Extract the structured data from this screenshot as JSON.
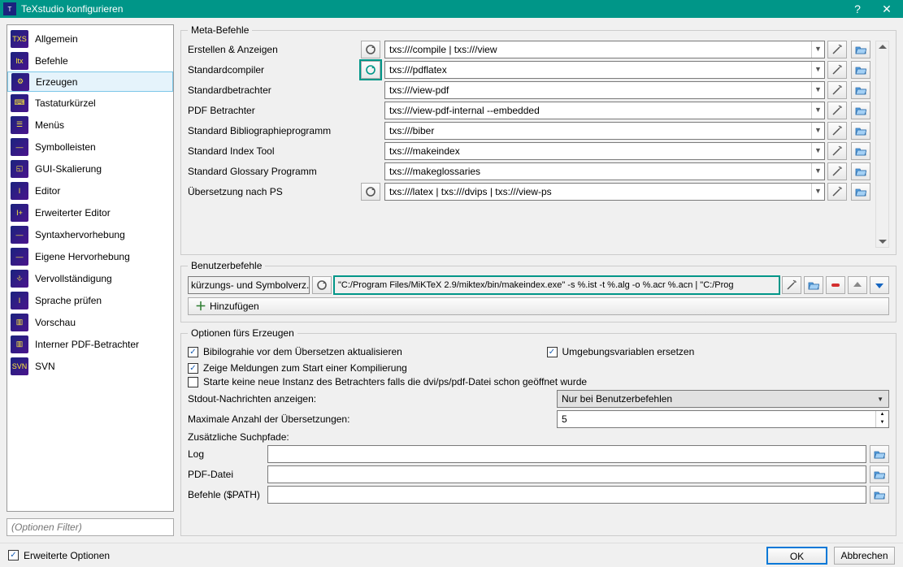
{
  "window": {
    "title": "TeXstudio konfigurieren"
  },
  "sidebar": {
    "items": [
      {
        "label": "Allgemein",
        "ico": "TXS"
      },
      {
        "label": "Befehle",
        "ico": "ltx"
      },
      {
        "label": "Erzeugen",
        "ico": "⚙"
      },
      {
        "label": "Tastaturkürzel",
        "ico": "⌨"
      },
      {
        "label": "Menüs",
        "ico": "☰"
      },
      {
        "label": "Symbolleisten",
        "ico": "—"
      },
      {
        "label": "GUI-Skalierung",
        "ico": "◱"
      },
      {
        "label": "Editor",
        "ico": "I"
      },
      {
        "label": "Erweiterter Editor",
        "ico": "I+"
      },
      {
        "label": "Syntaxhervorhebung",
        "ico": "—"
      },
      {
        "label": "Eigene Hervorhebung",
        "ico": "—"
      },
      {
        "label": "Vervollständigung",
        "ico": "⎀"
      },
      {
        "label": "Sprache prüfen",
        "ico": "I"
      },
      {
        "label": "Vorschau",
        "ico": "▥"
      },
      {
        "label": "Interner PDF-Betrachter",
        "ico": "▥"
      },
      {
        "label": "SVN",
        "ico": "SVN"
      }
    ],
    "selected_index": 2,
    "filter_placeholder": "(Optionen Filter)"
  },
  "meta": {
    "legend": "Meta-Befehle",
    "rows": [
      {
        "label": "Erstellen & Anzeigen",
        "rerun": true,
        "rerun_active": false,
        "value": "txs:///compile | txs:///view"
      },
      {
        "label": "Standardcompiler",
        "rerun": true,
        "rerun_active": true,
        "value": "txs:///pdflatex"
      },
      {
        "label": "Standardbetrachter",
        "rerun": false,
        "value": "txs:///view-pdf"
      },
      {
        "label": "PDF Betrachter",
        "rerun": false,
        "value": "txs:///view-pdf-internal --embedded"
      },
      {
        "label": "Standard Bibliographieprogramm",
        "rerun": false,
        "value": "txs:///biber"
      },
      {
        "label": "Standard Index Tool",
        "rerun": false,
        "value": "txs:///makeindex"
      },
      {
        "label": "Standard Glossary Programm",
        "rerun": false,
        "value": "txs:///makeglossaries"
      },
      {
        "label": "Übersetzung nach PS",
        "rerun": true,
        "rerun_active": false,
        "value": "txs:///latex | txs:///dvips | txs:///view-ps"
      }
    ]
  },
  "user": {
    "legend": "Benutzerbefehle",
    "name": "kürzungs- und Symbolverz.",
    "command": "\"C:/Program Files/MiKTeX 2.9/miktex/bin/makeindex.exe\" -s %.ist -t %.alg -o %.acr %.acn | \"C:/Prog",
    "add_label": "Hinzufügen"
  },
  "options": {
    "legend": "Optionen fürs Erzeugen",
    "chk_biblio": "Bibilograhie vor dem Übersetzen aktualisieren",
    "chk_env": "Umgebungsvariablen ersetzen",
    "chk_msgs": "Zeige Meldungen zum Start einer Kompilierung",
    "chk_instance": "Starte keine neue Instanz des Betrachters falls die dvi/ps/pdf-Datei schon geöffnet wurde",
    "stdout_label": "Stdout-Nachrichten anzeigen:",
    "stdout_value": "Nur bei Benutzerbefehlen",
    "maxcomp_label": "Maximale Anzahl der Übersetzungen:",
    "maxcomp_value": "5",
    "paths_label": "Zusätzliche Suchpfade:",
    "path_log": "Log",
    "path_pdf": "PDF-Datei",
    "path_cmd": "Befehle ($PATH)"
  },
  "footer": {
    "advanced": "Erweiterte Optionen",
    "ok": "OK",
    "cancel": "Abbrechen"
  }
}
